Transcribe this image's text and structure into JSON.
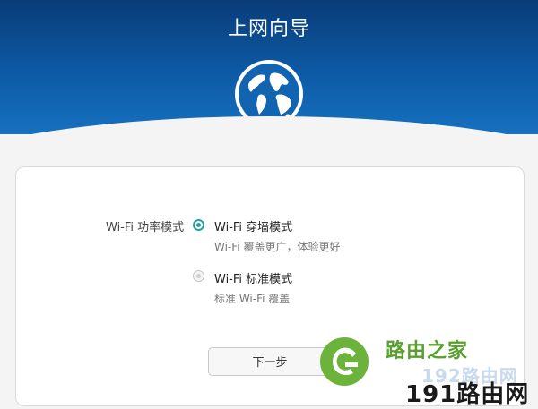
{
  "header": {
    "title": "上网向导"
  },
  "form": {
    "field_label": "Wi-Fi 功率模式",
    "options": [
      {
        "title": "Wi-Fi 穿墙模式",
        "desc": "Wi-Fi 覆盖更广，体验更好",
        "selected": true
      },
      {
        "title": "Wi-Fi 标准模式",
        "desc": "标准 Wi-Fi 覆盖",
        "selected": false
      }
    ],
    "next_label": "下一步"
  },
  "watermark": {
    "line1": "路由之家",
    "line2": "191路由网",
    "bg_text": "192路由网"
  },
  "colors": {
    "header_dark": "#0a3c78",
    "header_light": "#1771bf",
    "accent": "#2aa0a4",
    "watermark_green": "#5aa02c"
  }
}
